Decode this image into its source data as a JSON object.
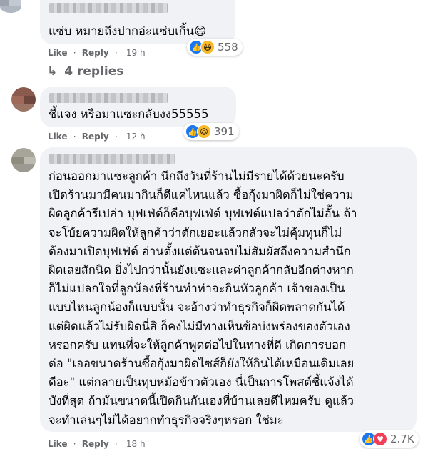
{
  "colors": {
    "bubble": "#f0f2f5",
    "meta": "#65676b",
    "like_blue": "#1877f2",
    "haha_yellow": "#f7b928",
    "love_red": "#f33e58"
  },
  "comments": [
    {
      "text_lines": [
        "แซ่บ หมายถึงปากอ่ะแซ่บเกิ้น😄"
      ],
      "like_label": "Like",
      "reply_label": "Reply",
      "separator": "·",
      "time": "19 h",
      "reactions": [
        "like-icon",
        "haha-icon"
      ],
      "reaction_count": "558"
    },
    {
      "text_lines": [
        "ชี้แจง หรือมาแซะกลับงง55555"
      ],
      "like_label": "Like",
      "reply_label": "Reply",
      "separator": "·",
      "time": "12 h",
      "reactions": [
        "like-icon",
        "haha-icon"
      ],
      "reaction_count": "391"
    },
    {
      "text_lines": [
        "ก่อนออกมาแซะลูกค้า นึกถึงวันที่ร้านไม่มีรายได้ด้วยนะครับ",
        "เปิดร้านมามีคนมากินก็ดีแค่ไหนแล้ว ซื้อกุ้งมาผิดก็ไม่ใช่ความ",
        "ผิดลูกค้ารึเปล่า บุฟเฟ่ต์ก็คือบุฟเฟ่ต์ บุฟเฟ่ต์แปลว่าตักไม่อั้น ถ้า",
        "จะโบ้ยความผิดให้ลูกค้าว่าตักเยอะแล้วกลัวจะไม่คุ้มทุนก็ไม่",
        "ต้องมาเปิดบุฟเฟ่ต์ อ่านตั้งแต่ต้นจนจบไม่สัมผัสถึงความสำนึก",
        "ผิดเลยสักนิด ยิ่งไปกว่านั้นยังแซะและด่าลูกค้ากลับอีกต่างหาก",
        "ก็ไม่แปลกใจที่ลูกน้องที่ร้านทำท่าจะกินหัวลูกค้า เจ้าของเป็น",
        "แบบไหนลูกน้องก็แบบนั้น จะอ้างว่าทำธุรกิจก็ผิดพลาดกันได้",
        "แต่ผิดแล้วไม่รับผิดนี่สิ ก็คงไม่มีทางเห็นข้อบ่งพร่องของตัวเอง",
        "หรอกครับ แทนที่จะให้ลูกค้าพูดต่อไปในทางที่ดี เกิดการบอก",
        "ต่อ \"เออขนาดร้านซื้อกุ้งมาผิดไซส์ก็ยังให้กินได้เหมือนเดิมเลย",
        "ดีอะ\" แต่กลายเป็นทุบหม้อข้าวตัวเอง นี่เป็นการโพสต์ชี้แจ้งได้",
        "บังที่สุด ถ้ามั่นขนาดนี้เปิดกินกันเองที่บ้านเลยดีไหมครับ ดูแล้ว",
        "จะทำเล่นๆไม่ได้อยากทำธุรกิจจริงๆหรอก ใช่มะ"
      ],
      "like_label": "Like",
      "reply_label": "Reply",
      "separator": "·",
      "time": "18 h",
      "reactions": [
        "like-icon",
        "love-icon"
      ],
      "reaction_count": "2.7K"
    }
  ],
  "replies_link": {
    "arrow": "↳",
    "label": "4 replies"
  }
}
